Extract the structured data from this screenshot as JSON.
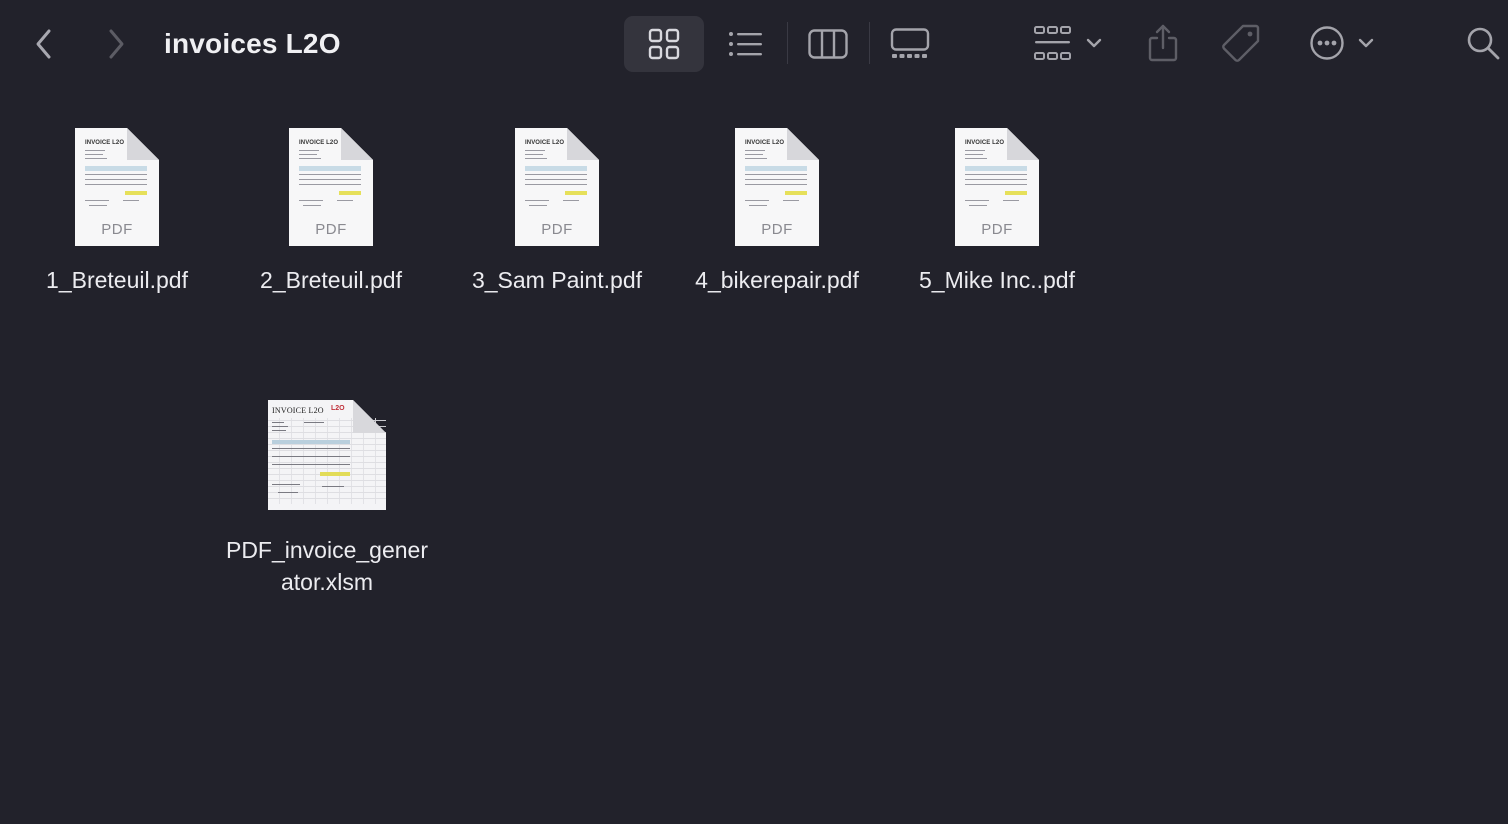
{
  "window": {
    "title": "invoices L2O"
  },
  "toolbar": {
    "back_icon": "chevron-left-icon",
    "forward_icon": "chevron-right-icon",
    "views": [
      {
        "name": "icon-view",
        "icon": "grid-icon",
        "active": true
      },
      {
        "name": "list-view",
        "icon": "list-icon",
        "active": false
      },
      {
        "name": "column-view",
        "icon": "columns-icon",
        "active": false
      },
      {
        "name": "gallery-view",
        "icon": "gallery-icon",
        "active": false
      }
    ],
    "group_icon": "group-grid-icon",
    "share_icon": "share-icon",
    "tag_icon": "tag-icon",
    "more_icon": "ellipsis-circle-icon",
    "search_icon": "search-icon"
  },
  "files": [
    {
      "name": "1_Breteuil.pdf",
      "type": "PDF",
      "thumb_title": "INVOICE L2O"
    },
    {
      "name": "2_Breteuil.pdf",
      "type": "PDF",
      "thumb_title": "INVOICE L2O"
    },
    {
      "name": "3_Sam Paint.pdf",
      "type": "PDF",
      "thumb_title": "INVOICE L2O"
    },
    {
      "name": "4_bikerepair.pdf",
      "type": "PDF",
      "thumb_title": "INVOICE L2O"
    },
    {
      "name": "5_Mike Inc..pdf",
      "type": "PDF",
      "thumb_title": "INVOICE L2O"
    },
    {
      "name": "PDF_invoice_generator.xlsm",
      "type": "XLSM",
      "thumb_title": "INVOICE L2O",
      "thumb_badge": "L2O"
    }
  ],
  "colors": {
    "background": "#22222b",
    "active_view_bg": "#34343d",
    "icon": "#a4a4ab"
  }
}
